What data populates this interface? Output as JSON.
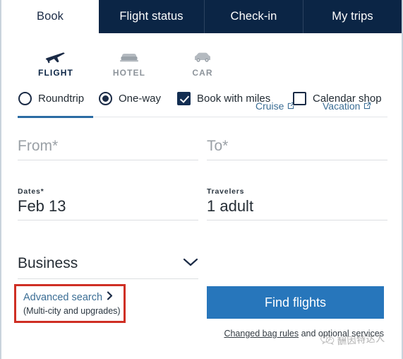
{
  "main_tabs": [
    {
      "label": "Book",
      "active": true
    },
    {
      "label": "Flight status",
      "active": false
    },
    {
      "label": "Check-in",
      "active": false
    },
    {
      "label": "My trips",
      "active": false
    }
  ],
  "product_tabs": [
    {
      "label": "FLIGHT",
      "icon": "airplane-icon",
      "active": true
    },
    {
      "label": "HOTEL",
      "icon": "bed-icon",
      "active": false
    },
    {
      "label": "CAR",
      "icon": "car-icon",
      "active": false
    }
  ],
  "external_links": [
    {
      "label": "Cruise",
      "icon": "external-link-icon"
    },
    {
      "label": "Vacation",
      "icon": "external-link-icon"
    }
  ],
  "trip_options": [
    {
      "label": "Roundtrip",
      "type": "radio",
      "checked": false
    },
    {
      "label": "One-way",
      "type": "radio",
      "checked": true
    },
    {
      "label": "Book with miles",
      "type": "checkbox",
      "checked": true
    },
    {
      "label": "Calendar shop",
      "type": "checkbox",
      "checked": false
    }
  ],
  "fields": {
    "from": {
      "placeholder": "From*"
    },
    "to": {
      "placeholder": "To*"
    },
    "dates": {
      "label": "Dates*",
      "value": "Feb 13"
    },
    "travelers": {
      "label": "Travelers",
      "value": "1 adult"
    }
  },
  "cabin": {
    "value": "Business",
    "chevron": "chevron-down-icon"
  },
  "advanced_search": {
    "link": "Advanced search",
    "chevron": "chevron-right-icon",
    "sublabel": "(Multi-city and upgrades)"
  },
  "find_button": {
    "label": "Find flights"
  },
  "footnote": {
    "link_text": "Changed bag rules",
    "rest_text": " and optional services"
  },
  "watermark": {
    "text": "酬因特达人",
    "icon": "wechat-icon"
  },
  "colors": {
    "header_navy": "#0b2545",
    "accent_blue": "#2776bb",
    "underline_blue": "#2b6ca3",
    "link_blue": "#3b6e95",
    "annotation_red": "#cf2f24",
    "checkbox_navy": "#132e52"
  }
}
